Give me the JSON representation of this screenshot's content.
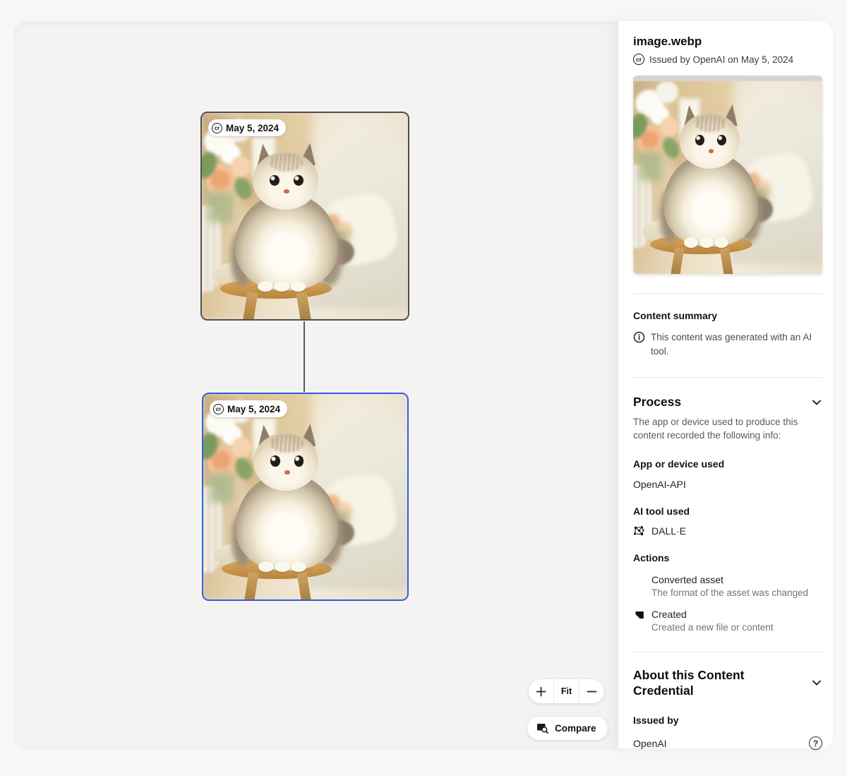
{
  "canvas": {
    "nodes": [
      {
        "badge_date": "May 5, 2024",
        "selected": false
      },
      {
        "badge_date": "May 5, 2024",
        "selected": true
      }
    ],
    "zoom_controls": {
      "zoom_in_icon": "plus-icon",
      "fit_label": "Fit",
      "zoom_out_icon": "minus-icon"
    },
    "compare_button": {
      "label": "Compare",
      "icon": "compare-icon"
    }
  },
  "sidebar": {
    "title": "image.webp",
    "issuer_line": "Issued by OpenAI on May 5, 2024",
    "cr_icon": "cr",
    "summary": {
      "heading": "Content summary",
      "info_icon": "info-icon",
      "text": "This content was generated with an AI tool."
    },
    "process": {
      "heading": "Process",
      "description": "The app or device used to produce this content recorded the following info:",
      "app_label": "App or device used",
      "app_value": "OpenAI-API",
      "ai_tool_label": "AI tool used",
      "ai_tool_icon": "dalle-icon",
      "ai_tool_value": "DALL·E",
      "actions_label": "Actions",
      "actions": [
        {
          "title": "Converted asset",
          "description": "The format of the asset was changed"
        },
        {
          "title": "Created",
          "description": "Created a new file or content",
          "icon": "created-icon"
        }
      ]
    },
    "about": {
      "heading": "About this Content Credential",
      "issued_by_label": "Issued by",
      "issued_by_value": "OpenAI",
      "help_icon": "question-icon"
    }
  },
  "colors": {
    "selected_node_border": "#2f5ee0",
    "node_border": "#4f4f4f",
    "canvas_bg": "#f4f3f1",
    "sidebar_bg": "#ffffff"
  }
}
